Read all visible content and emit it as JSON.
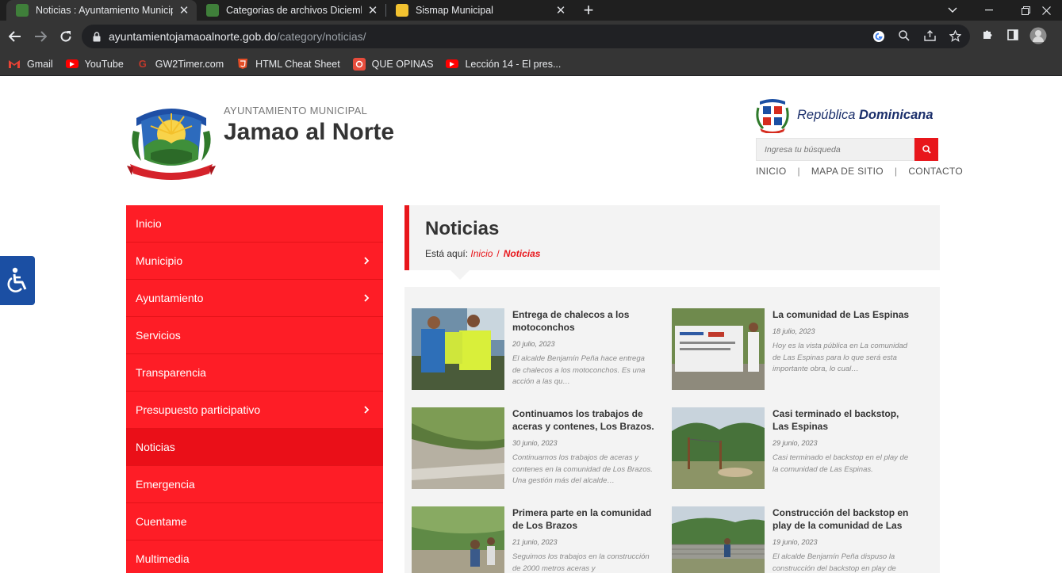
{
  "browser": {
    "tabs": [
      {
        "title": "Noticias : Ayuntamiento Municipal",
        "fav_color": "#3f7f3a"
      },
      {
        "title": "Categorias de archivos Diciembre",
        "fav_color": "#3f7f3a"
      },
      {
        "title": "Sismap Municipal",
        "fav_color": "#f2c230"
      }
    ],
    "new_tab": "+",
    "url_host": "ayuntamientojamaoalnorte.gob.do",
    "url_path": "/category/noticias/",
    "bookmarks": [
      {
        "label": "Gmail",
        "icon": "gmail-icon",
        "color": "#ea4335"
      },
      {
        "label": "YouTube",
        "icon": "youtube-icon",
        "color": "#ff0000"
      },
      {
        "label": "GW2Timer.com",
        "icon": "gw2-icon",
        "color": "#c0392b"
      },
      {
        "label": "HTML Cheat Sheet",
        "icon": "html-icon",
        "color": "#e44d26"
      },
      {
        "label": "QUE OPINAS",
        "icon": "opinas-icon",
        "color": "#e74c3c"
      },
      {
        "label": "Lección 14 - El pres...",
        "icon": "youtube-icon",
        "color": "#ff0000"
      }
    ]
  },
  "site": {
    "supertitle": "AYUNTAMIENTO MUNICIPAL",
    "title": "Jamao al Norte",
    "republica_light": "República",
    "republica_bold": "Dominicana",
    "search_placeholder": "Ingresa tu búsqueda",
    "top_links": [
      "INICIO",
      "MAPA DE SITIO",
      "CONTACTO"
    ],
    "accent": "#fe1d26"
  },
  "sidebar": {
    "items": [
      {
        "label": "Inicio",
        "has_children": false
      },
      {
        "label": "Municipio",
        "has_children": true
      },
      {
        "label": "Ayuntamiento",
        "has_children": true
      },
      {
        "label": "Servicios",
        "has_children": false
      },
      {
        "label": "Transparencia",
        "has_children": false
      },
      {
        "label": "Presupuesto participativo",
        "has_children": true
      },
      {
        "label": "Noticias",
        "has_children": false,
        "active": true
      },
      {
        "label": "Emergencia",
        "has_children": false
      },
      {
        "label": "Cuentame",
        "has_children": false
      },
      {
        "label": "Multimedia",
        "has_children": false
      }
    ]
  },
  "content": {
    "title": "Noticias",
    "breadcrumb_prefix": "Está aquí:",
    "breadcrumb_home": "Inicio",
    "breadcrumb_sep": "/",
    "breadcrumb_current": "Noticias",
    "posts": [
      {
        "title": "Entrega de chalecos a los motoconchos",
        "date": "20 julio, 2023",
        "excerpt": "El alcalde Benjamín Peña hace entrega de chalecos a los motoconchos. Es una acción a las qu…"
      },
      {
        "title": "La comunidad de Las Espinas",
        "date": "18 julio, 2023",
        "excerpt": "Hoy es la vista pública en La comunidad de Las Espinas para lo que será esta importante obra, lo cual…"
      },
      {
        "title": "Continuamos los trabajos de aceras y contenes, Los Brazos.",
        "date": "30 junio, 2023",
        "excerpt": "Continuamos los trabajos de aceras y contenes en la comunidad de Los Brazos. Una gestión más del alcalde…"
      },
      {
        "title": "Casi terminado el backstop, Las Espinas",
        "date": "29 junio, 2023",
        "excerpt": "Casi terminado el backstop en el play de la comunidad de Las Espinas."
      },
      {
        "title": "Primera parte en la comunidad de Los Brazos",
        "date": "21 junio, 2023",
        "excerpt": "Seguimos los trabajos en la construcción de 2000 metros aceras y"
      },
      {
        "title": "Construcción del backstop en play de la comunidad de Las",
        "date": "19 junio, 2023",
        "excerpt": "El alcalde Benjamín Peña dispuso la construcción del backstop en play de"
      }
    ]
  }
}
